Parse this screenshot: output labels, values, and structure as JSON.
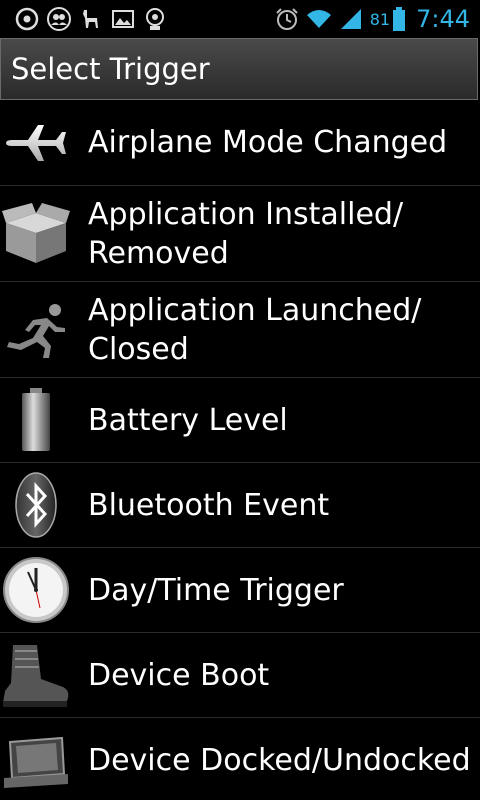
{
  "status_bar": {
    "battery_percent": "81",
    "time": "7:44",
    "accent_color": "#33b5e5",
    "left_icons": [
      "notification-circle-icon",
      "people-icon",
      "llama-icon",
      "image-icon",
      "app-icon"
    ],
    "right_icons": [
      "alarm-clock-icon",
      "wifi-icon",
      "signal-icon",
      "battery-icon"
    ]
  },
  "title_bar": {
    "title": "Select Trigger"
  },
  "triggers": [
    {
      "label": "Airplane Mode Changed",
      "icon": "airplane-icon"
    },
    {
      "label": "Application Installed/ Removed",
      "icon": "package-box-icon"
    },
    {
      "label": "Application Launched/ Closed",
      "icon": "running-man-icon"
    },
    {
      "label": "Battery Level",
      "icon": "battery-icon"
    },
    {
      "label": "Bluetooth Event",
      "icon": "bluetooth-icon"
    },
    {
      "label": "Day/Time Trigger",
      "icon": "clock-icon"
    },
    {
      "label": "Device Boot",
      "icon": "boot-icon"
    },
    {
      "label": "Device Docked/Undocked",
      "icon": "dock-icon"
    }
  ]
}
